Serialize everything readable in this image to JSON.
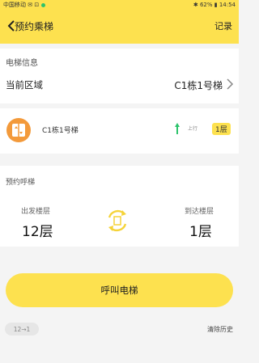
{
  "status_bar": {
    "left_text": "中国移动 ✉ ⊡",
    "right_text": "✱ 62% ▮ 14:54"
  },
  "nav": {
    "title": "预约乘梯",
    "record_label": "记录"
  },
  "elevator_info": {
    "section_label": "电梯信息",
    "area_label": "当前区域",
    "area_value": "C1栋1号梯"
  },
  "elevator_card": {
    "name": "C1栋1号梯",
    "direction_text": "上行",
    "floor_badge": "1层"
  },
  "reservation": {
    "section_label": "预约呼梯",
    "from_label": "出发楼层",
    "from_value": "12层",
    "to_label": "到达楼层",
    "to_value": "1层"
  },
  "call_button_label": "呼叫电梯",
  "history_chip": "12→1",
  "clear_history_label": "清除历史",
  "colors": {
    "accent": "#fde14f",
    "elevator_icon_bg": "#f39a3b",
    "arrow_green": "#2cc36b"
  },
  "icons": [
    "back-chevron-icon",
    "chevron-right-icon",
    "elevator-icon",
    "up-arrow-icon",
    "swap-icon"
  ]
}
